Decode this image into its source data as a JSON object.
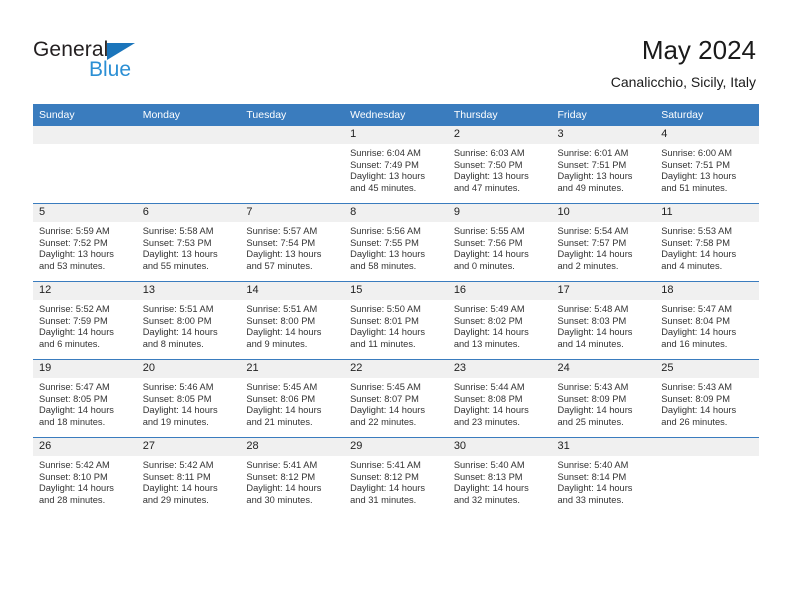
{
  "brand": {
    "name_top": "General",
    "name_bottom": "Blue",
    "triangle_color": "#1b75bb",
    "text_color": "#231f20",
    "blue_text_color": "#2b8fd4"
  },
  "header": {
    "title": "May 2024",
    "subtitle": "Canalicchio, Sicily, Italy"
  },
  "theme": {
    "header_bg": "#3a7cbe",
    "header_text": "#ffffff",
    "daynum_bg": "#f0f0f0",
    "grid_line": "#3a7cbe",
    "page_bg": "#ffffff"
  },
  "weekdays": [
    "Sunday",
    "Monday",
    "Tuesday",
    "Wednesday",
    "Thursday",
    "Friday",
    "Saturday"
  ],
  "weeks": [
    [
      {
        "day": "",
        "sunrise": "",
        "sunset": "",
        "daylight_line1": "",
        "daylight_line2": ""
      },
      {
        "day": "",
        "sunrise": "",
        "sunset": "",
        "daylight_line1": "",
        "daylight_line2": ""
      },
      {
        "day": "",
        "sunrise": "",
        "sunset": "",
        "daylight_line1": "",
        "daylight_line2": ""
      },
      {
        "day": "1",
        "sunrise": "Sunrise: 6:04 AM",
        "sunset": "Sunset: 7:49 PM",
        "daylight_line1": "Daylight: 13 hours",
        "daylight_line2": "and 45 minutes."
      },
      {
        "day": "2",
        "sunrise": "Sunrise: 6:03 AM",
        "sunset": "Sunset: 7:50 PM",
        "daylight_line1": "Daylight: 13 hours",
        "daylight_line2": "and 47 minutes."
      },
      {
        "day": "3",
        "sunrise": "Sunrise: 6:01 AM",
        "sunset": "Sunset: 7:51 PM",
        "daylight_line1": "Daylight: 13 hours",
        "daylight_line2": "and 49 minutes."
      },
      {
        "day": "4",
        "sunrise": "Sunrise: 6:00 AM",
        "sunset": "Sunset: 7:51 PM",
        "daylight_line1": "Daylight: 13 hours",
        "daylight_line2": "and 51 minutes."
      }
    ],
    [
      {
        "day": "5",
        "sunrise": "Sunrise: 5:59 AM",
        "sunset": "Sunset: 7:52 PM",
        "daylight_line1": "Daylight: 13 hours",
        "daylight_line2": "and 53 minutes."
      },
      {
        "day": "6",
        "sunrise": "Sunrise: 5:58 AM",
        "sunset": "Sunset: 7:53 PM",
        "daylight_line1": "Daylight: 13 hours",
        "daylight_line2": "and 55 minutes."
      },
      {
        "day": "7",
        "sunrise": "Sunrise: 5:57 AM",
        "sunset": "Sunset: 7:54 PM",
        "daylight_line1": "Daylight: 13 hours",
        "daylight_line2": "and 57 minutes."
      },
      {
        "day": "8",
        "sunrise": "Sunrise: 5:56 AM",
        "sunset": "Sunset: 7:55 PM",
        "daylight_line1": "Daylight: 13 hours",
        "daylight_line2": "and 58 minutes."
      },
      {
        "day": "9",
        "sunrise": "Sunrise: 5:55 AM",
        "sunset": "Sunset: 7:56 PM",
        "daylight_line1": "Daylight: 14 hours",
        "daylight_line2": "and 0 minutes."
      },
      {
        "day": "10",
        "sunrise": "Sunrise: 5:54 AM",
        "sunset": "Sunset: 7:57 PM",
        "daylight_line1": "Daylight: 14 hours",
        "daylight_line2": "and 2 minutes."
      },
      {
        "day": "11",
        "sunrise": "Sunrise: 5:53 AM",
        "sunset": "Sunset: 7:58 PM",
        "daylight_line1": "Daylight: 14 hours",
        "daylight_line2": "and 4 minutes."
      }
    ],
    [
      {
        "day": "12",
        "sunrise": "Sunrise: 5:52 AM",
        "sunset": "Sunset: 7:59 PM",
        "daylight_line1": "Daylight: 14 hours",
        "daylight_line2": "and 6 minutes."
      },
      {
        "day": "13",
        "sunrise": "Sunrise: 5:51 AM",
        "sunset": "Sunset: 8:00 PM",
        "daylight_line1": "Daylight: 14 hours",
        "daylight_line2": "and 8 minutes."
      },
      {
        "day": "14",
        "sunrise": "Sunrise: 5:51 AM",
        "sunset": "Sunset: 8:00 PM",
        "daylight_line1": "Daylight: 14 hours",
        "daylight_line2": "and 9 minutes."
      },
      {
        "day": "15",
        "sunrise": "Sunrise: 5:50 AM",
        "sunset": "Sunset: 8:01 PM",
        "daylight_line1": "Daylight: 14 hours",
        "daylight_line2": "and 11 minutes."
      },
      {
        "day": "16",
        "sunrise": "Sunrise: 5:49 AM",
        "sunset": "Sunset: 8:02 PM",
        "daylight_line1": "Daylight: 14 hours",
        "daylight_line2": "and 13 minutes."
      },
      {
        "day": "17",
        "sunrise": "Sunrise: 5:48 AM",
        "sunset": "Sunset: 8:03 PM",
        "daylight_line1": "Daylight: 14 hours",
        "daylight_line2": "and 14 minutes."
      },
      {
        "day": "18",
        "sunrise": "Sunrise: 5:47 AM",
        "sunset": "Sunset: 8:04 PM",
        "daylight_line1": "Daylight: 14 hours",
        "daylight_line2": "and 16 minutes."
      }
    ],
    [
      {
        "day": "19",
        "sunrise": "Sunrise: 5:47 AM",
        "sunset": "Sunset: 8:05 PM",
        "daylight_line1": "Daylight: 14 hours",
        "daylight_line2": "and 18 minutes."
      },
      {
        "day": "20",
        "sunrise": "Sunrise: 5:46 AM",
        "sunset": "Sunset: 8:05 PM",
        "daylight_line1": "Daylight: 14 hours",
        "daylight_line2": "and 19 minutes."
      },
      {
        "day": "21",
        "sunrise": "Sunrise: 5:45 AM",
        "sunset": "Sunset: 8:06 PM",
        "daylight_line1": "Daylight: 14 hours",
        "daylight_line2": "and 21 minutes."
      },
      {
        "day": "22",
        "sunrise": "Sunrise: 5:45 AM",
        "sunset": "Sunset: 8:07 PM",
        "daylight_line1": "Daylight: 14 hours",
        "daylight_line2": "and 22 minutes."
      },
      {
        "day": "23",
        "sunrise": "Sunrise: 5:44 AM",
        "sunset": "Sunset: 8:08 PM",
        "daylight_line1": "Daylight: 14 hours",
        "daylight_line2": "and 23 minutes."
      },
      {
        "day": "24",
        "sunrise": "Sunrise: 5:43 AM",
        "sunset": "Sunset: 8:09 PM",
        "daylight_line1": "Daylight: 14 hours",
        "daylight_line2": "and 25 minutes."
      },
      {
        "day": "25",
        "sunrise": "Sunrise: 5:43 AM",
        "sunset": "Sunset: 8:09 PM",
        "daylight_line1": "Daylight: 14 hours",
        "daylight_line2": "and 26 minutes."
      }
    ],
    [
      {
        "day": "26",
        "sunrise": "Sunrise: 5:42 AM",
        "sunset": "Sunset: 8:10 PM",
        "daylight_line1": "Daylight: 14 hours",
        "daylight_line2": "and 28 minutes."
      },
      {
        "day": "27",
        "sunrise": "Sunrise: 5:42 AM",
        "sunset": "Sunset: 8:11 PM",
        "daylight_line1": "Daylight: 14 hours",
        "daylight_line2": "and 29 minutes."
      },
      {
        "day": "28",
        "sunrise": "Sunrise: 5:41 AM",
        "sunset": "Sunset: 8:12 PM",
        "daylight_line1": "Daylight: 14 hours",
        "daylight_line2": "and 30 minutes."
      },
      {
        "day": "29",
        "sunrise": "Sunrise: 5:41 AM",
        "sunset": "Sunset: 8:12 PM",
        "daylight_line1": "Daylight: 14 hours",
        "daylight_line2": "and 31 minutes."
      },
      {
        "day": "30",
        "sunrise": "Sunrise: 5:40 AM",
        "sunset": "Sunset: 8:13 PM",
        "daylight_line1": "Daylight: 14 hours",
        "daylight_line2": "and 32 minutes."
      },
      {
        "day": "31",
        "sunrise": "Sunrise: 5:40 AM",
        "sunset": "Sunset: 8:14 PM",
        "daylight_line1": "Daylight: 14 hours",
        "daylight_line2": "and 33 minutes."
      },
      {
        "day": "",
        "sunrise": "",
        "sunset": "",
        "daylight_line1": "",
        "daylight_line2": ""
      }
    ]
  ]
}
